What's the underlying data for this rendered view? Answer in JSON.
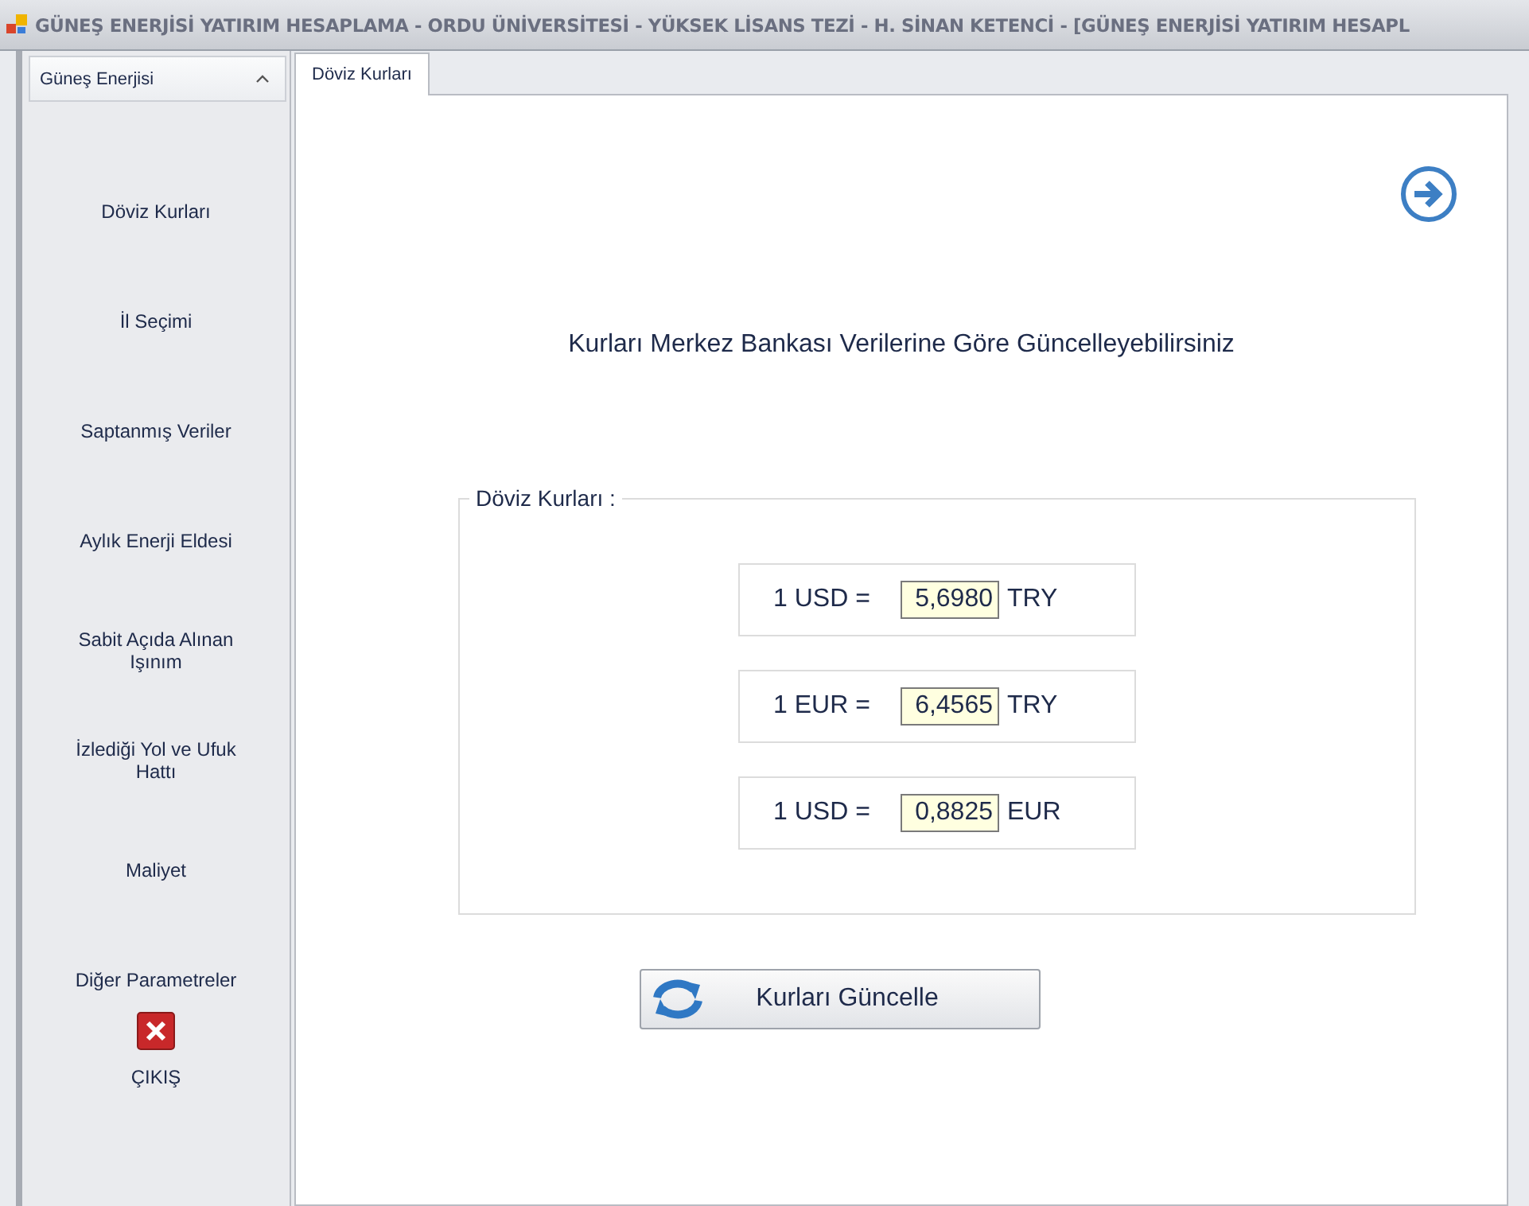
{
  "window": {
    "title": "GÜNEŞ ENERJİSİ YATIRIM HESAPLAMA - ORDU ÜNİVERSİTESİ - YÜKSEK LİSANS TEZİ - H. SİNAN KETENCİ - [GÜNEŞ ENERJİSİ YATIRIM HESAPL"
  },
  "sidebar": {
    "header": "Güneş Enerjisi",
    "items": [
      {
        "kind": "link",
        "label": "Döviz Kurları"
      },
      {
        "kind": "link",
        "label": "İl Seçimi"
      },
      {
        "kind": "link",
        "label": "Saptanmış Veriler"
      },
      {
        "kind": "link",
        "label": "Aylık Enerji Eldesi"
      },
      {
        "kind": "link",
        "label": "Sabit Açıda Alınan Işınım"
      },
      {
        "kind": "link",
        "label": "İzlediği Yol ve Ufuk Hattı"
      },
      {
        "kind": "link",
        "label": "Maliyet"
      },
      {
        "kind": "link",
        "label": "Diğer Parametreler"
      },
      {
        "kind": "exit",
        "label": "ÇIKIŞ"
      }
    ]
  },
  "tabs": [
    {
      "label": "Döviz Kurları",
      "selected": true
    }
  ],
  "heading": "Kurları Merkez Bankası Verilerine Göre Güncelleyebilirsiniz",
  "group": {
    "title": "Döviz Kurları :",
    "rates": [
      {
        "label": "1 USD =",
        "value": "5,6980",
        "unit": "TRY"
      },
      {
        "label": "1 EUR =",
        "value": "6,4565",
        "unit": "TRY"
      },
      {
        "label": "1 USD =",
        "value": "0,8825",
        "unit": "EUR"
      }
    ]
  },
  "update_button": "Kurları Güncelle"
}
